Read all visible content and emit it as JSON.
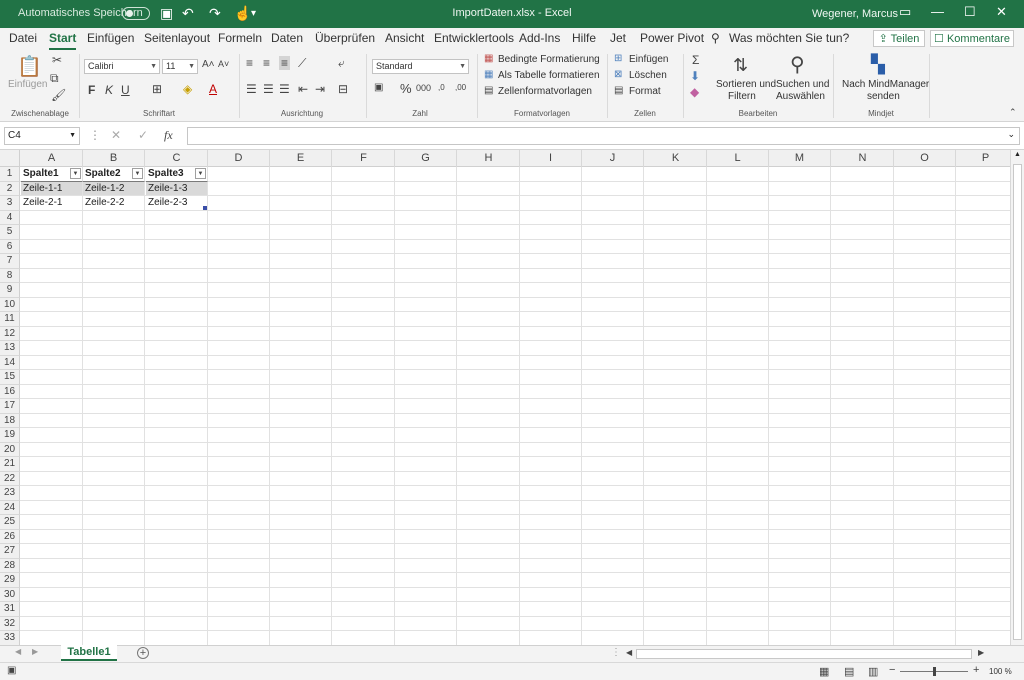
{
  "titlebar": {
    "autosave_label": "Automatisches Speichern",
    "title": "ImportDaten.xlsx  -  Excel",
    "user": "Wegener, Marcus"
  },
  "tabs": [
    "Datei",
    "Start",
    "Einfügen",
    "Seitenlayout",
    "Formeln",
    "Daten",
    "Überprüfen",
    "Ansicht",
    "Entwicklertools",
    "Add-Ins",
    "Hilfe",
    "Jet",
    "Power Pivot"
  ],
  "active_tab": "Start",
  "tell_me": "Was möchten Sie tun?",
  "share_label": "Teilen",
  "comments_label": "Kommentare",
  "ribbon": {
    "clipboard": {
      "paste": "Einfügen",
      "label": "Zwischenablage"
    },
    "font": {
      "name": "Calibri",
      "size": "11",
      "bold": "F",
      "italic": "K",
      "underline": "U",
      "label": "Schriftart"
    },
    "alignment": {
      "label": "Ausrichtung"
    },
    "number": {
      "format": "Standard",
      "label": "Zahl"
    },
    "styles": {
      "cond": "Bedingte Formatierung",
      "table": "Als Tabelle formatieren",
      "cell": "Zellenformatvorlagen",
      "label": "Formatvorlagen"
    },
    "cells": {
      "insert": "Einfügen",
      "delete": "Löschen",
      "format": "Format",
      "label": "Zellen"
    },
    "editing": {
      "sort1": "Sortieren und",
      "sort2": "Filtern",
      "find1": "Suchen und",
      "find2": "Auswählen",
      "label": "Bearbeiten"
    },
    "mindjet": {
      "send1": "Nach MindManager",
      "send2": "senden",
      "label": "Mindjet"
    }
  },
  "formula_bar": {
    "name_box": "C4",
    "fx": "fx"
  },
  "grid": {
    "columns": [
      "A",
      "B",
      "C",
      "D",
      "E",
      "F",
      "G",
      "H",
      "I",
      "J",
      "K",
      "L",
      "M",
      "N",
      "O",
      "P"
    ],
    "rows": [
      "1",
      "2",
      "3",
      "4",
      "5",
      "6",
      "7",
      "8",
      "9",
      "10",
      "11",
      "12",
      "13",
      "14",
      "15",
      "16",
      "17",
      "18",
      "19",
      "20",
      "21",
      "22",
      "23",
      "24",
      "25",
      "26",
      "27",
      "28",
      "29",
      "30",
      "31",
      "32",
      "33"
    ],
    "table": {
      "headers": [
        "Spalte1",
        "Spalte2",
        "Spalte3"
      ],
      "rows": [
        [
          "Zeile-1-1",
          "Zeile-1-2",
          "Zeile-1-3"
        ],
        [
          "Zeile-2-1",
          "Zeile-2-2",
          "Zeile-2-3"
        ]
      ]
    }
  },
  "sheets": [
    "Tabelle1"
  ],
  "status": {
    "zoom": "100 %"
  }
}
